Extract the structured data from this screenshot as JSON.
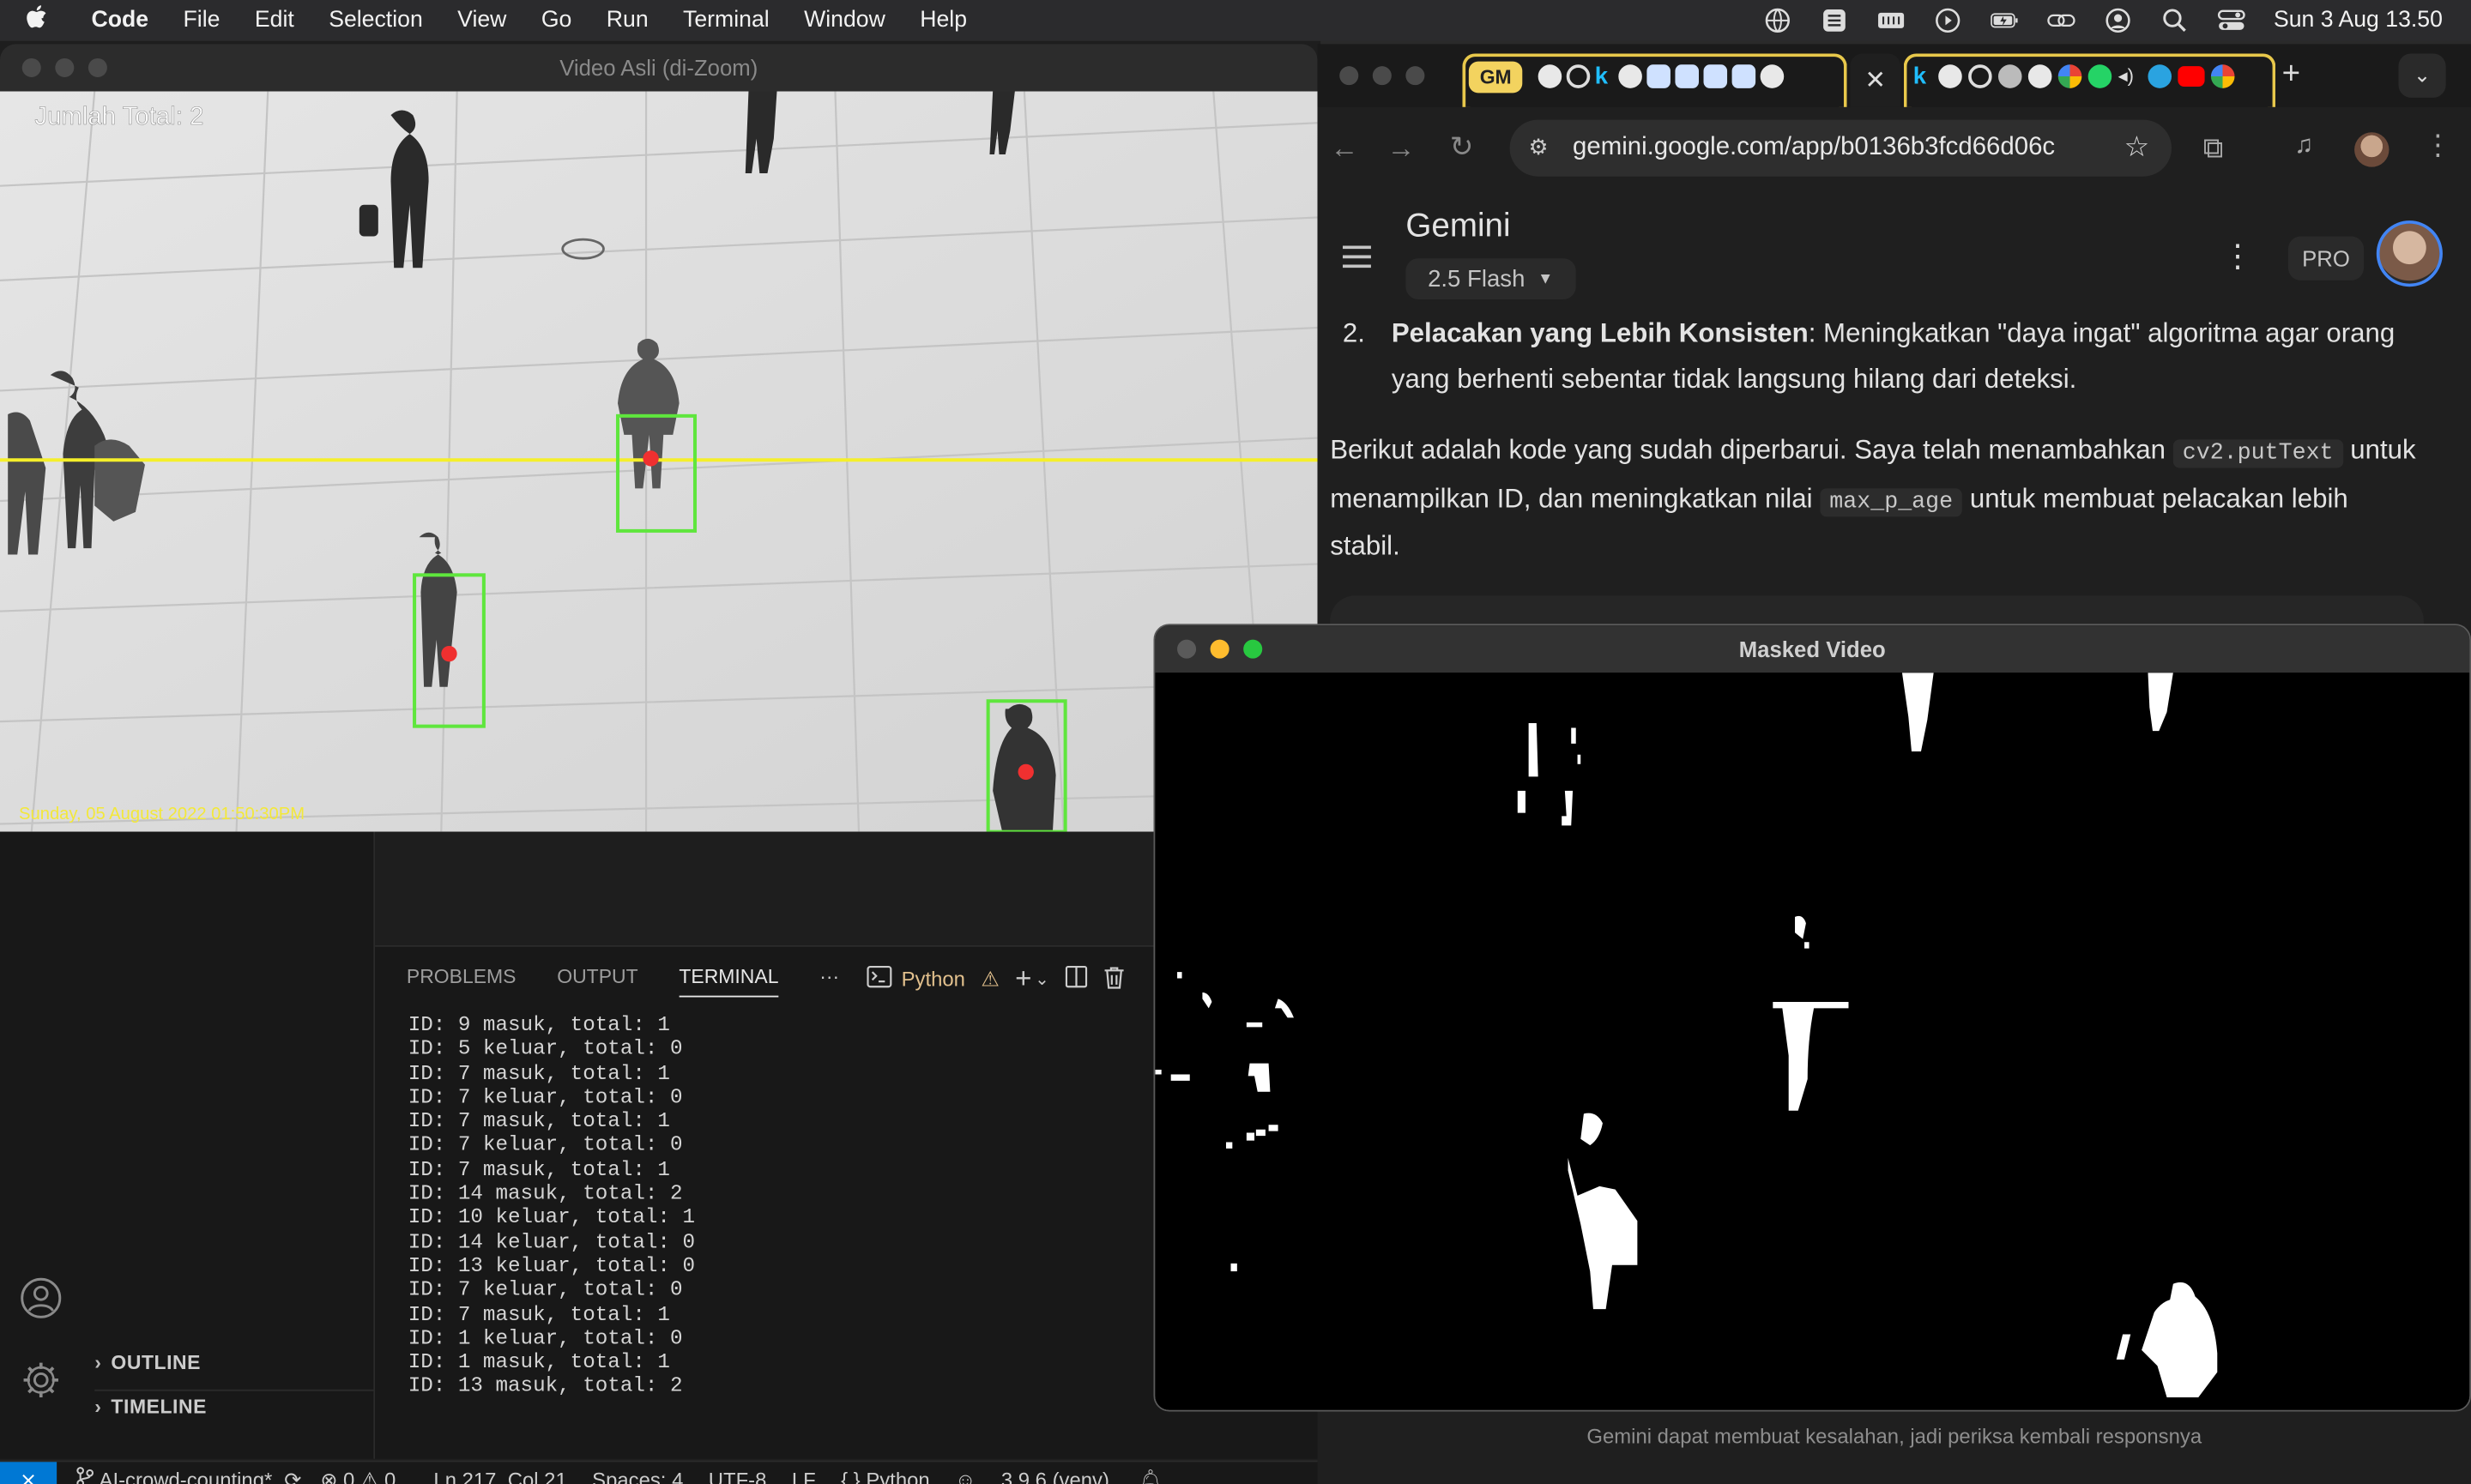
{
  "menubar": {
    "apple": "",
    "items": [
      "Code",
      "File",
      "Edit",
      "Selection",
      "View",
      "Go",
      "Run",
      "Terminal",
      "Window",
      "Help"
    ],
    "clock": "Sun 3 Aug  13.50"
  },
  "video_window": {
    "title": "Video Asli (di-Zoom)",
    "count_text": "Jumlah Total: 2",
    "timestamp_text": "Sunday, 05 August 2022 01:50:30PM"
  },
  "mask_window": {
    "title": "Masked Video"
  },
  "vscode": {
    "sidebar_sections": [
      "OUTLINE",
      "TIMELINE"
    ],
    "panel_tabs": [
      "PROBLEMS",
      "OUTPUT",
      "TERMINAL"
    ],
    "panel_more": "···",
    "terminal_profile": "Python",
    "terminal_lines": [
      "ID: 9 masuk, total: 1",
      "ID: 5 keluar, total: 0",
      "ID: 7 masuk, total: 1",
      "ID: 7 keluar, total: 0",
      "ID: 7 masuk, total: 1",
      "ID: 7 keluar, total: 0",
      "ID: 7 masuk, total: 1",
      "ID: 14 masuk, total: 2",
      "ID: 10 keluar, total: 1",
      "ID: 14 keluar, total: 0",
      "ID: 13 keluar, total: 0",
      "ID: 7 keluar, total: 0",
      "ID: 7 masuk, total: 1",
      "ID: 1 keluar, total: 0",
      "ID: 1 masuk, total: 1",
      "ID: 13 masuk, total: 2"
    ],
    "status": {
      "branch": "AI-crowd-counting*",
      "errors": "0",
      "warnings": "0",
      "position": "Ln 217, Col 21",
      "spaces": "Spaces: 4",
      "encoding": "UTF-8",
      "eol": "LF",
      "language": "Python",
      "interpreter": "3.9.6 (venv)"
    }
  },
  "browser": {
    "tab_group_label": "GM",
    "url": "gemini.google.com/app/b0136b3fcd66d06c",
    "app_name": "Gemini",
    "model": "2.5 Flash",
    "pro_badge": "PRO",
    "list_number": "2.",
    "list_bold": "Pelacakan yang Lebih Konsisten",
    "list_text": ": Meningkatkan \"daya ingat\" algoritma agar orang yang berhenti sebentar tidak langsung hilang dari deteksi.",
    "para_1": "Berikut adalah kode yang sudah diperbarui. Saya telah menambahkan",
    "code_1": "cv2.putText",
    "para_2": "untuk menampilkan ID, dan meningkatkan nilai",
    "code_2": "max_p_age",
    "para_3": "untuk membuat pelacakan lebih stabil.",
    "disclaimer": "Gemini dapat membuat kesalahan, jadi periksa kembali responsnya"
  }
}
